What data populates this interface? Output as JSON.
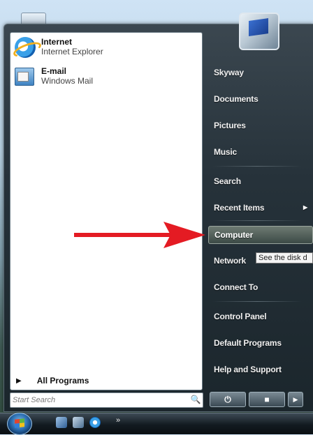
{
  "pinned": [
    {
      "title": "Internet",
      "subtitle": "Internet Explorer",
      "icon": "internet-explorer-icon"
    },
    {
      "title": "E-mail",
      "subtitle": "Windows Mail",
      "icon": "windows-mail-icon"
    }
  ],
  "all_programs": {
    "arrow": "▶",
    "label": "All Programs"
  },
  "search": {
    "placeholder": "Start Search",
    "button_icon": "search-icon"
  },
  "right_pane": {
    "items": [
      {
        "label": "Skyway"
      },
      {
        "label": "Documents"
      },
      {
        "label": "Pictures"
      },
      {
        "label": "Music"
      },
      {
        "label": "Search"
      },
      {
        "label": "Recent Items",
        "submenu": "▶"
      },
      {
        "label": "Computer",
        "hover": true
      },
      {
        "label": "Network"
      },
      {
        "label": "Connect To"
      },
      {
        "label": "Control Panel"
      },
      {
        "label": "Default Programs"
      },
      {
        "label": "Help and Support"
      }
    ]
  },
  "tooltip": {
    "text": "See the disk d"
  },
  "power": {
    "power_glyph": "⏻",
    "lock_glyph": "🔒",
    "more_glyph": "▶"
  },
  "taskbar": {
    "expand_glyph": "»"
  },
  "colors": {
    "arrow": "#e41b23",
    "menu_bg": "#26323a",
    "hover": "#4f5d57"
  }
}
